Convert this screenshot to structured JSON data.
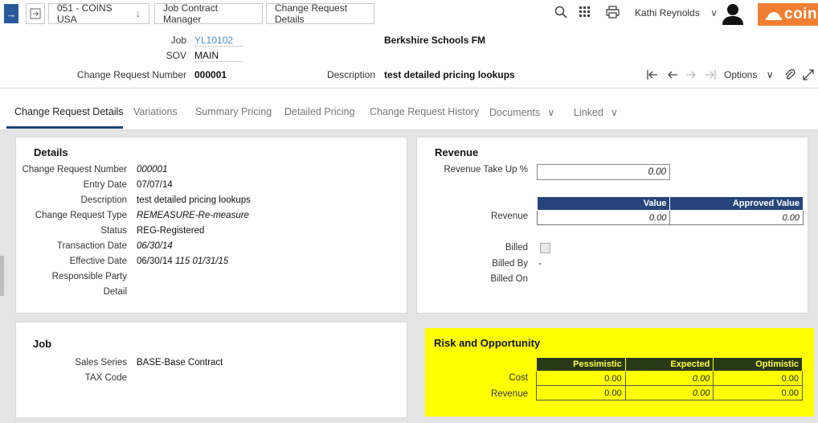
{
  "topbar": {
    "company": "051 - COINS USA",
    "breadcrumbs": [
      "Job Contract Manager",
      "Change Request Details"
    ],
    "user": "Kathi Reynolds",
    "logo_text": "coin"
  },
  "header": {
    "job_label": "Job",
    "job_value": "YL10102",
    "job_name": "Berkshire Schools FM",
    "sov_label": "SOV",
    "sov_value": "MAIN",
    "cr_number_label": "Change Request Number",
    "cr_number_value": "000001",
    "description_label": "Description",
    "description_value": "test detailed pricing lookups",
    "options_label": "Options"
  },
  "tabs": [
    {
      "label": "Change Request Details"
    },
    {
      "label": "Variations"
    },
    {
      "label": "Summary Pricing"
    },
    {
      "label": "Detailed Pricing"
    },
    {
      "label": "Change Request History"
    },
    {
      "label": "Documents"
    },
    {
      "label": "Linked"
    }
  ],
  "details": {
    "title": "Details",
    "fields": [
      {
        "label": "Change Request Number",
        "value": "000001"
      },
      {
        "label": "Entry Date",
        "value": "07/07/14"
      },
      {
        "label": "Description",
        "value": "test detailed pricing lookups"
      },
      {
        "label": "Change Request Type",
        "value": "REMEASURE-Re-measure"
      },
      {
        "label": "Status",
        "value": "REG-Registered"
      },
      {
        "label": "Transaction Date",
        "value": "06/30/14"
      },
      {
        "label": "Effective Date",
        "value": "06/30/14",
        "extra": "115 01/31/15"
      },
      {
        "label": "Responsible Party",
        "value": ""
      },
      {
        "label": "Detail",
        "value": ""
      }
    ]
  },
  "revenue": {
    "title": "Revenue",
    "take_up_label": "Revenue Take Up %",
    "take_up_value": "0.00",
    "columns": [
      "Value",
      "Approved Value"
    ],
    "row_label": "Revenue",
    "row_values": [
      "0.00",
      "0.00"
    ],
    "billed_label": "Billed",
    "billed_by_label": "Billed By",
    "billed_by_value": "-",
    "billed_on_label": "Billed On"
  },
  "job": {
    "title": "Job",
    "fields": [
      {
        "label": "Sales Series",
        "value": "BASE-Base Contract"
      },
      {
        "label": "TAX Code",
        "value": ""
      }
    ]
  },
  "risk": {
    "title": "Risk and Opportunity",
    "columns": [
      "Pessimistic",
      "Expected",
      "Optimistic"
    ],
    "rows": [
      {
        "label": "Cost",
        "values": [
          "0.00",
          "0.00",
          "0.00"
        ]
      },
      {
        "label": "Revenue",
        "values": [
          "0.00",
          "0.00",
          "0.00"
        ]
      }
    ],
    "highlight_color": "#ffff00"
  }
}
